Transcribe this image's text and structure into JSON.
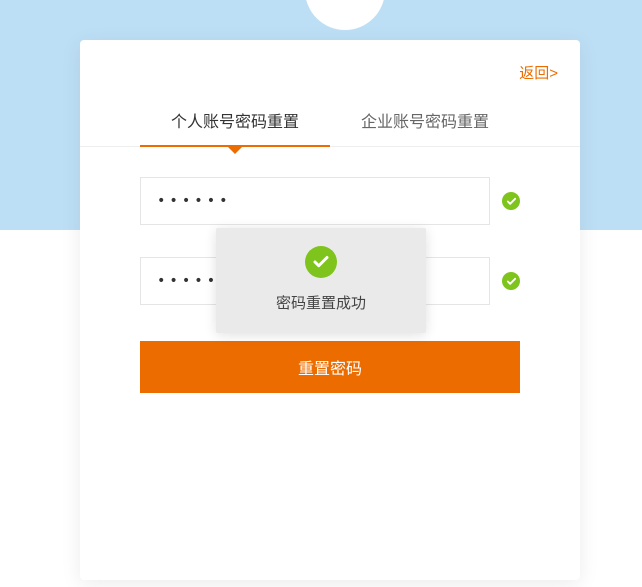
{
  "header": {
    "back_label": "返回>"
  },
  "tabs": {
    "personal": "个人账号密码重置",
    "enterprise": "企业账号密码重置"
  },
  "form": {
    "password1": "••••••",
    "password2": "••••••",
    "submit_label": "重置密码"
  },
  "toast": {
    "message": "密码重置成功"
  }
}
